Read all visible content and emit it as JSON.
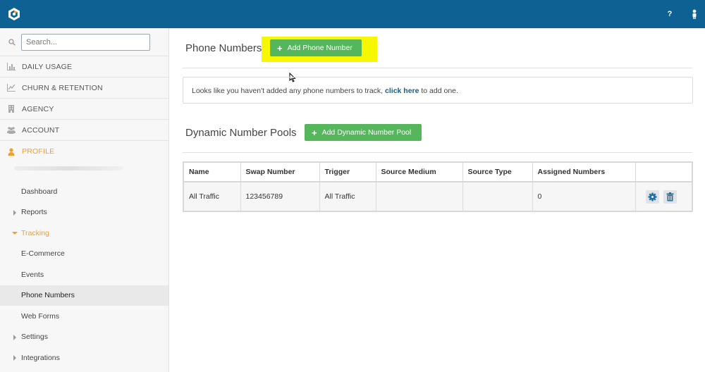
{
  "topbar": {
    "logo_icon": "brand-logo-icon",
    "help_label": "?",
    "user_icon": "user-icon",
    "background": "#0d6193"
  },
  "sidebar": {
    "search": {
      "placeholder": "Search..."
    },
    "main_items": [
      {
        "label": "DAILY USAGE",
        "icon": "bar-chart-icon"
      },
      {
        "label": "CHURN & RETENTION",
        "icon": "line-chart-icon"
      },
      {
        "label": "AGENCY",
        "icon": "building-icon"
      },
      {
        "label": "ACCOUNT",
        "icon": "users-icon"
      },
      {
        "label": "PROFILE",
        "icon": "user-icon",
        "active": true
      }
    ],
    "sub_items": [
      {
        "label": "Dashboard"
      },
      {
        "label": "Reports"
      },
      {
        "label": "Tracking"
      },
      {
        "label": "E-Commerce"
      },
      {
        "label": "Events"
      },
      {
        "label": "Phone Numbers"
      },
      {
        "label": "Web Forms"
      },
      {
        "label": "Settings"
      },
      {
        "label": "Integrations"
      }
    ]
  },
  "main": {
    "phone_numbers": {
      "title": "Phone Numbers",
      "add_button": "Add Phone Number"
    },
    "notice": {
      "text_before": "Looks like you haven't added any phone numbers to track, ",
      "link": "click here",
      "text_after": " to add one."
    },
    "pools": {
      "title": "Dynamic Number Pools",
      "add_button": "Add Dynamic Number Pool",
      "columns": [
        "Name",
        "Swap Number",
        "Trigger",
        "Source Medium",
        "Source Type",
        "Assigned Numbers",
        ""
      ],
      "rows": [
        {
          "name": "All Traffic",
          "swap_number": "123456789",
          "trigger": "All Traffic",
          "source_medium": "",
          "source_type": "",
          "assigned_numbers": "0"
        }
      ]
    }
  },
  "colors": {
    "accent_green": "#56b65b",
    "active_orange": "#f0a02d",
    "highlight_yellow": "#f7f700",
    "link_blue": "#0d6193"
  }
}
